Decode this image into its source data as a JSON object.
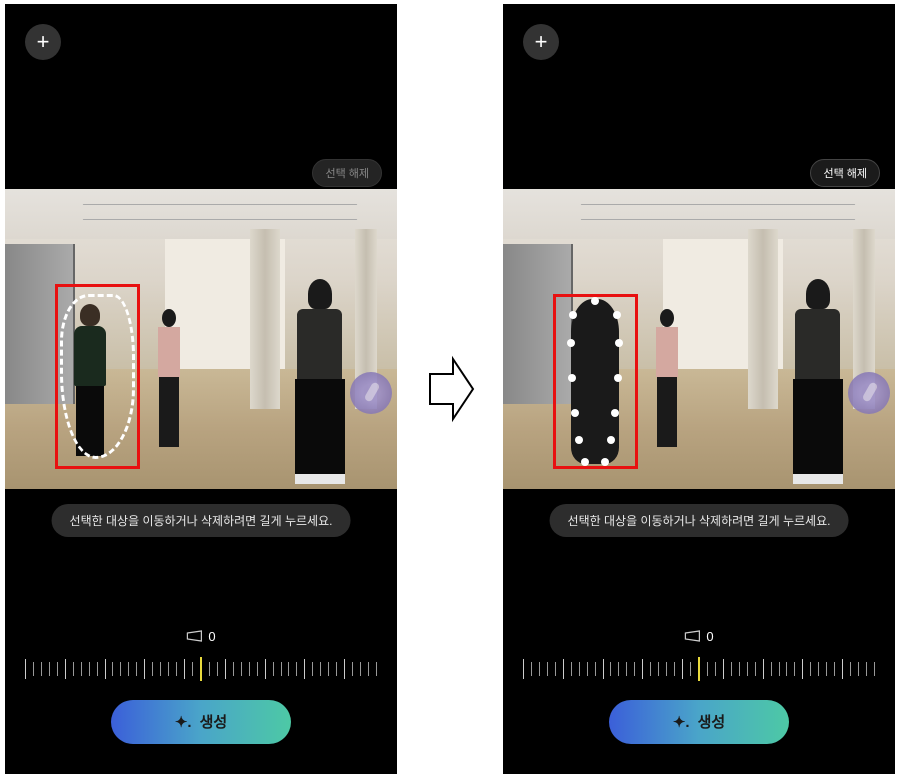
{
  "left_screen": {
    "plus_button": "+",
    "deselect_label": "선택 해제",
    "hint_text": "선택한 대상을 이동하거나 삭제하려면 길게 누르세요.",
    "angle_value": "0",
    "generate_label": "생성",
    "selection_state": "lasso"
  },
  "right_screen": {
    "plus_button": "+",
    "deselect_label": "선택 해제",
    "hint_text": "선택한 대상을 이동하거나 삭제하려면 길게 누르세요.",
    "angle_value": "0",
    "generate_label": "생성",
    "selection_state": "filled"
  },
  "icons": {
    "plus": "plus-icon",
    "perspective": "perspective-icon",
    "sparkle": "sparkle-icon",
    "arrow": "arrow-right-icon"
  }
}
